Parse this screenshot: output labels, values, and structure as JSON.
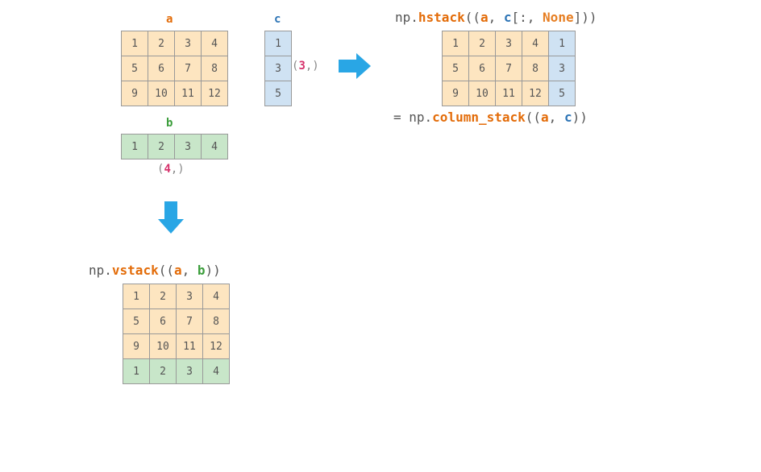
{
  "labels": {
    "a": "a",
    "b": "b",
    "c": "c"
  },
  "shapes": {
    "c_open": "(",
    "c_val": "3",
    "c_close": ",)",
    "b_open": "(",
    "b_val": "4",
    "b_close": ",)"
  },
  "code": {
    "hstack_prefix": "np.",
    "hstack_fn": "hstack",
    "hstack_open": "((",
    "hstack_a": "a",
    "hstack_mid": ", ",
    "hstack_c": "c",
    "hstack_slice_open": "[:, ",
    "hstack_none": "None",
    "hstack_close": "]))",
    "colstack_eq": "= np.",
    "colstack_fn": "column_stack",
    "colstack_open": "((",
    "colstack_a": "a",
    "colstack_mid": ", ",
    "colstack_c": "c",
    "colstack_close": "))",
    "vstack_prefix": "np.",
    "vstack_fn": "vstack",
    "vstack_open": "((",
    "vstack_a": "a",
    "vstack_mid": ", ",
    "vstack_b": "b",
    "vstack_close": "))"
  },
  "chart_data": {
    "type": "table",
    "arrays": {
      "a": [
        [
          1,
          2,
          3,
          4
        ],
        [
          5,
          6,
          7,
          8
        ],
        [
          9,
          10,
          11,
          12
        ]
      ],
      "b": [
        1,
        2,
        3,
        4
      ],
      "c": [
        1,
        3,
        5
      ]
    },
    "operations": [
      {
        "expr": "np.hstack((a, c[:, None]))",
        "result": [
          [
            1,
            2,
            3,
            4,
            1
          ],
          [
            5,
            6,
            7,
            8,
            3
          ],
          [
            9,
            10,
            11,
            12,
            5
          ]
        ]
      },
      {
        "expr": "np.column_stack((a, c))",
        "equivalent_to": "np.hstack((a, c[:, None]))"
      },
      {
        "expr": "np.vstack((a, b))",
        "result": [
          [
            1,
            2,
            3,
            4
          ],
          [
            5,
            6,
            7,
            8
          ],
          [
            9,
            10,
            11,
            12
          ],
          [
            1,
            2,
            3,
            4
          ]
        ]
      }
    ]
  }
}
